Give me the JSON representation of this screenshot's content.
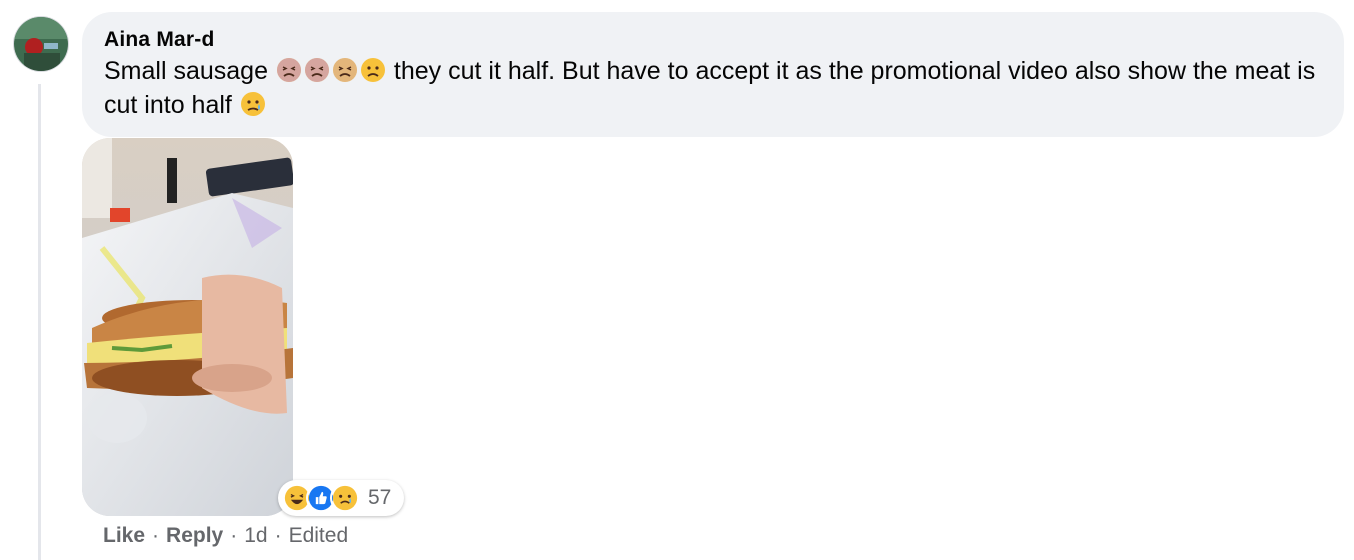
{
  "comment": {
    "author": "Aina Mar-d",
    "text_part1": "Small sausage",
    "text_part2": "they cut it half. But have to accept it as the promotional video also show the meat is cut into half",
    "emojis_line": [
      "tired-face-emoji",
      "tired-face-emoji",
      "tired-face-emoji",
      "frowning-face-emoji"
    ],
    "emoji_end": "sad-tear-emoji"
  },
  "reactions": {
    "icons": [
      "haha-icon",
      "like-icon",
      "sad-icon"
    ],
    "count": "57"
  },
  "actions": {
    "like": "Like",
    "reply": "Reply",
    "time": "1d",
    "edited": "Edited",
    "separator": "·"
  },
  "colors": {
    "bubble": "#f0f2f5",
    "text": "#050505",
    "meta": "#65676b",
    "like_blue": "#1877f2"
  }
}
